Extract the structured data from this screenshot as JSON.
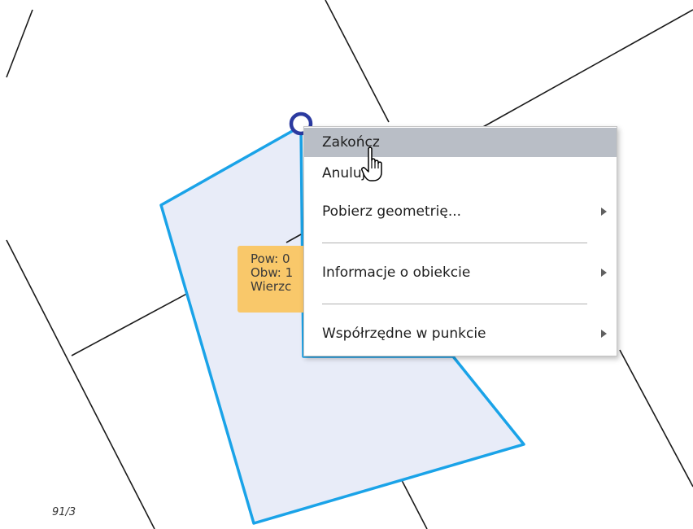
{
  "measurement_tooltip": {
    "lines": [
      "Pow: 0",
      "Obw: 1",
      "Wierzc"
    ]
  },
  "parcel_label": "91/3",
  "context_menu": {
    "items": [
      {
        "label": "Zakończ",
        "highlighted": true,
        "submenu": false
      },
      {
        "label": "Anuluj",
        "highlighted": false,
        "submenu": false
      },
      {
        "label": "Pobierz geometrię...",
        "highlighted": false,
        "submenu": true
      },
      {
        "label": "Informacje o obiekcie",
        "highlighted": false,
        "submenu": true
      },
      {
        "label": "Współrzędne w punkcie",
        "highlighted": false,
        "submenu": true
      }
    ]
  },
  "colors": {
    "polygon_stroke": "#1aa3e8",
    "polygon_fill": "#e8ecf8",
    "vertex_marker": "#2b3aa0",
    "tooltip_bg": "#f9c86a",
    "menu_highlight": "#b9bec6"
  },
  "icons": {
    "cursor": "hand-pointer-icon",
    "submenu": "triangle-right-icon"
  }
}
